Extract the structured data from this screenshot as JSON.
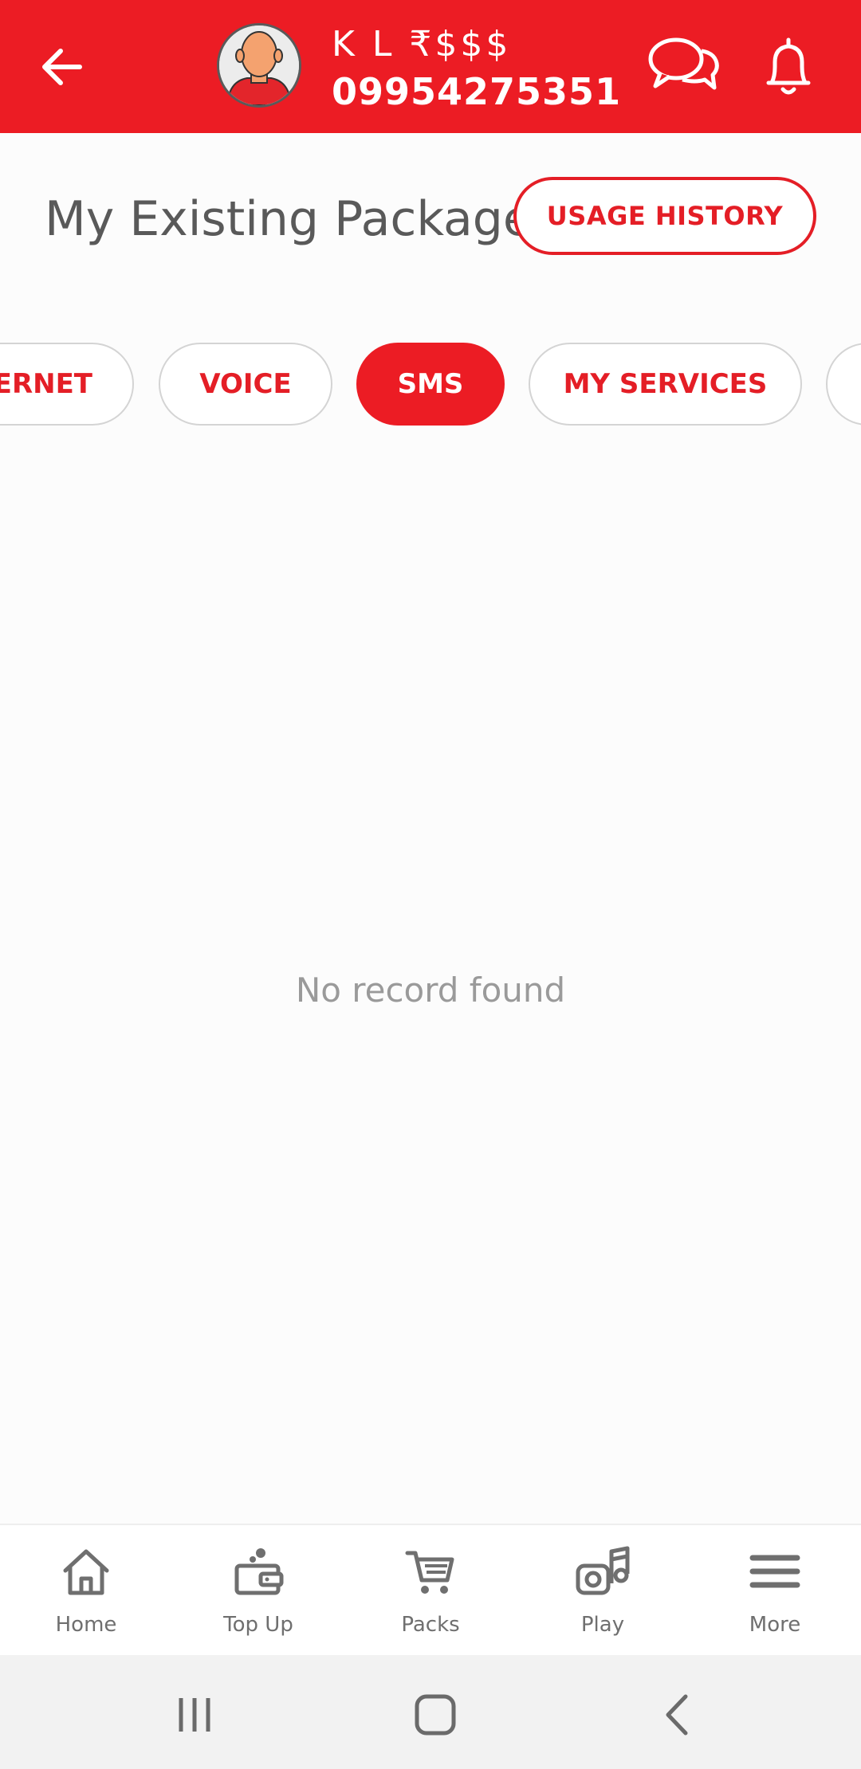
{
  "header": {
    "user_name": "K L ₹$$$",
    "phone": "09954275351",
    "icons": [
      "back-arrow-icon",
      "avatar",
      "chat-icon",
      "bell-icon"
    ]
  },
  "page": {
    "title": "My Existing Package",
    "usage_history_label": "USAGE HISTORY"
  },
  "tabs": [
    {
      "label": "ERNET",
      "active": false
    },
    {
      "label": "VOICE",
      "active": false
    },
    {
      "label": "SMS",
      "active": true
    },
    {
      "label": "MY SERVICES",
      "active": false
    },
    {
      "label": "",
      "active": false
    }
  ],
  "content": {
    "empty_message": "No record found"
  },
  "bottom_nav": [
    {
      "label": "Home",
      "icon": "home-icon"
    },
    {
      "label": "Top Up",
      "icon": "wallet-icon"
    },
    {
      "label": "Packs",
      "icon": "cart-icon"
    },
    {
      "label": "Play",
      "icon": "music-icon"
    },
    {
      "label": "More",
      "icon": "menu-icon"
    }
  ],
  "colors": {
    "brand_red": "#ec1c24",
    "text_gray": "#595959",
    "muted_gray": "#9a9a9a"
  }
}
